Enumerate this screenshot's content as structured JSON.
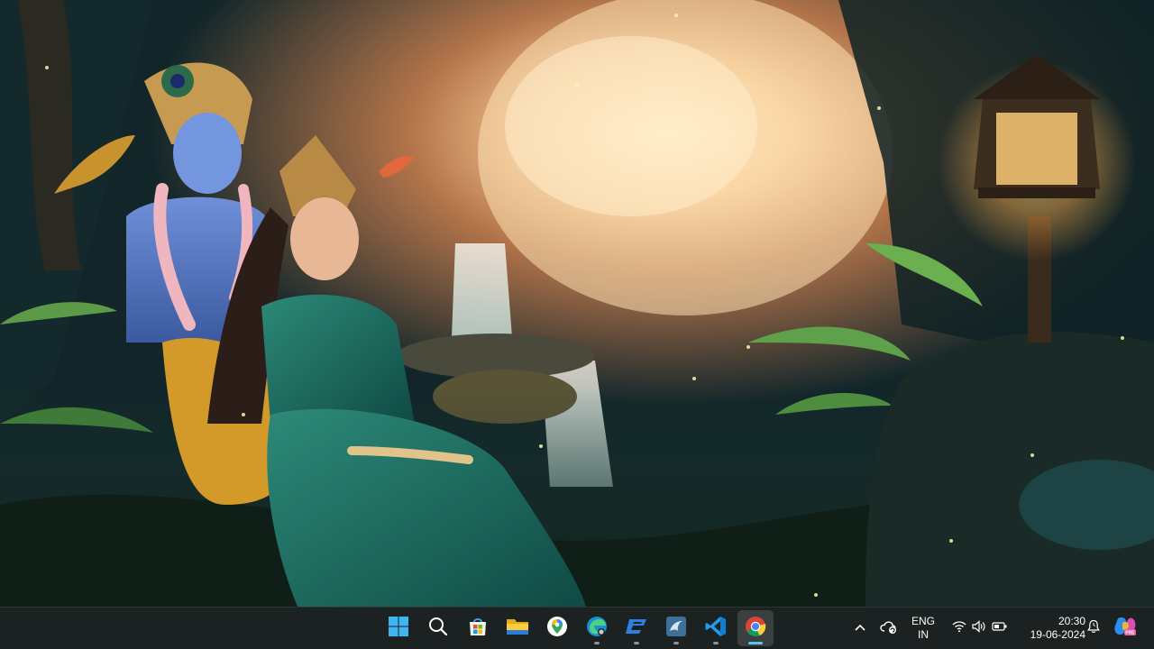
{
  "desktop": {
    "wallpaper": "Radha Krishna forest wallpaper with waterfall and lantern"
  },
  "taskbar": {
    "background": "#1c2122",
    "pinned_apps": [
      {
        "name": "Start",
        "icon": "windows-start-icon"
      },
      {
        "name": "Search",
        "icon": "search-icon"
      },
      {
        "name": "Microsoft Store",
        "icon": "store-icon"
      },
      {
        "name": "File Explorer",
        "icon": "folder-icon"
      },
      {
        "name": "Maps",
        "icon": "maps-pin-icon"
      },
      {
        "name": "Microsoft Edge Beta",
        "icon": "edge-icon"
      },
      {
        "name": "App",
        "icon": "blue-logo-icon"
      },
      {
        "name": "MySQL Workbench",
        "icon": "mysql-workbench-icon"
      },
      {
        "name": "Visual Studio Code",
        "icon": "vscode-icon"
      },
      {
        "name": "Google Chrome",
        "icon": "chrome-icon",
        "active": true
      }
    ],
    "tray": {
      "language": {
        "line1": "ENG",
        "line2": "IN"
      },
      "time": "20:30",
      "date": "19-06-2024"
    },
    "accent": "#5cc4f5"
  }
}
